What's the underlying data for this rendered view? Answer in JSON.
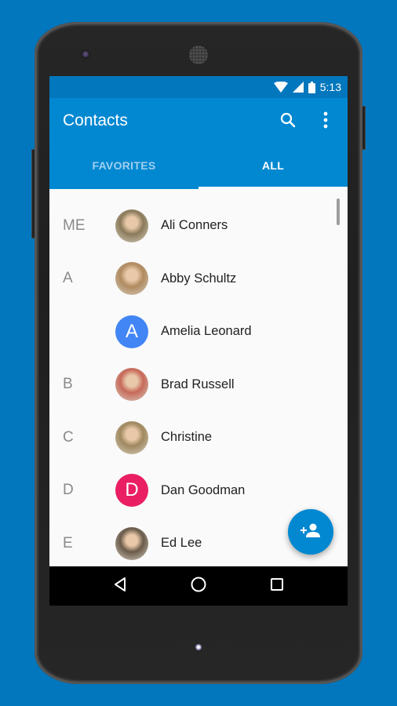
{
  "status_bar": {
    "time": "5:13",
    "icons": [
      "wifi-icon",
      "cell-signal-icon",
      "battery-icon"
    ]
  },
  "app_bar": {
    "title": "Contacts",
    "actions": [
      "search-icon",
      "more-vert-icon"
    ]
  },
  "tabs": [
    {
      "label": "FAVORITES",
      "active": false
    },
    {
      "label": "ALL",
      "active": true
    }
  ],
  "contacts": [
    {
      "section": "ME",
      "name": "Ali Conners",
      "avatar_type": "photo",
      "avatar_color": "#8a7a5a"
    },
    {
      "section": "A",
      "name": "Abby Schultz",
      "avatar_type": "photo",
      "avatar_color": "#b08a60"
    },
    {
      "section": "",
      "name": "Amelia Leonard",
      "avatar_type": "letter",
      "initial": "A",
      "avatar_color": "#4285f4"
    },
    {
      "section": "B",
      "name": "Brad Russell",
      "avatar_type": "photo",
      "avatar_color": "#c7695a"
    },
    {
      "section": "C",
      "name": "Christine",
      "avatar_type": "photo",
      "avatar_color": "#a08860"
    },
    {
      "section": "D",
      "name": "Dan Goodman",
      "avatar_type": "letter",
      "initial": "D",
      "avatar_color": "#e91e63"
    },
    {
      "section": "E",
      "name": "Ed Lee",
      "avatar_type": "photo",
      "avatar_color": "#6a5a4a"
    }
  ],
  "fab": {
    "icon": "add-person-icon"
  },
  "nav_bar": {
    "buttons": [
      "back-icon",
      "home-icon",
      "recents-icon"
    ]
  },
  "colors": {
    "background": "#0277bd",
    "status_bar": "#0277bd",
    "app_bar": "#0288d1",
    "fab": "#0288d1"
  }
}
